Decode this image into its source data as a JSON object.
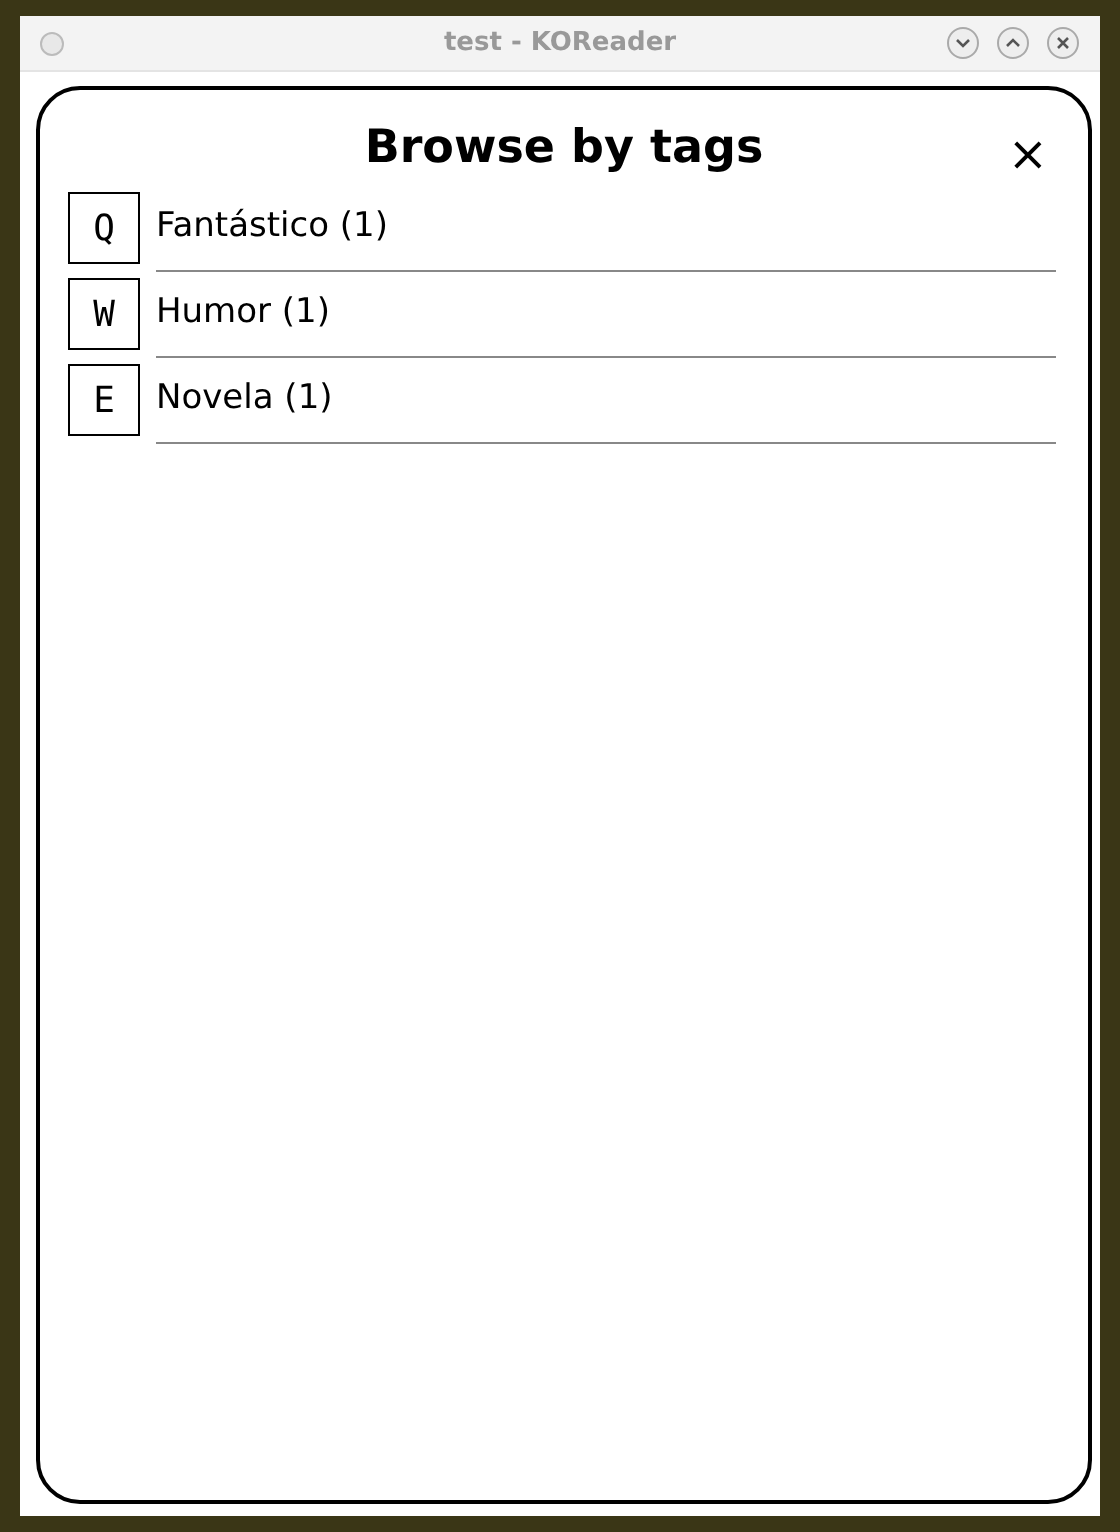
{
  "window": {
    "title": "test - KOReader"
  },
  "dialog": {
    "title": "Browse by tags",
    "close": "×"
  },
  "items": [
    {
      "key": "Q",
      "label": "Fantástico (1)"
    },
    {
      "key": "W",
      "label": "Humor (1)"
    },
    {
      "key": "E",
      "label": "Novela (1)"
    }
  ]
}
